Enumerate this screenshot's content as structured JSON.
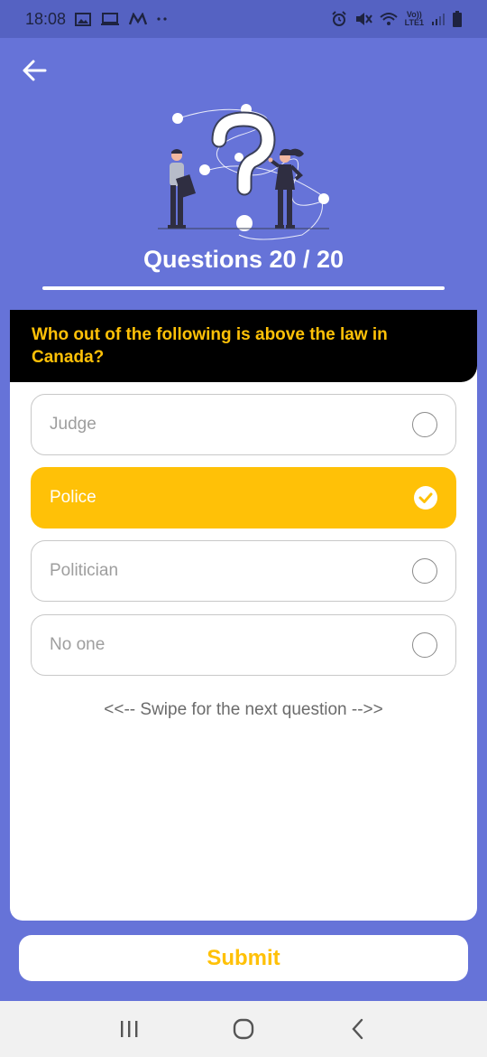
{
  "status_bar": {
    "time": "18:08",
    "left_icons": [
      "gallery-icon",
      "laptop-icon",
      "m-app-icon",
      "more-dots-icon"
    ],
    "right_icons": [
      "alarm-icon",
      "mute-icon",
      "wifi-icon",
      "volte-icon",
      "signal-icon",
      "battery-icon"
    ],
    "volte_top": "Vo))",
    "volte_bottom": "LTE1"
  },
  "header": {
    "back_icon": "arrow-left-icon",
    "illustration": "question-mark-people-illustration",
    "progress": "Questions 20 / 20"
  },
  "question": {
    "text": "Who out of the following is above the law in Canada?"
  },
  "options": [
    {
      "label": "Judge",
      "selected": false
    },
    {
      "label": "Police",
      "selected": true
    },
    {
      "label": "Politician",
      "selected": false
    },
    {
      "label": "No one",
      "selected": false
    }
  ],
  "swipe_hint": "<<-- Swipe for the next question -->>",
  "submit_label": "Submit",
  "nav_bar": {
    "icons": [
      "recent-apps-icon",
      "home-icon",
      "back-icon"
    ]
  },
  "colors": {
    "background": "#6673d8",
    "accent": "#ffc107",
    "question_bg": "#000000",
    "card": "#ffffff"
  }
}
